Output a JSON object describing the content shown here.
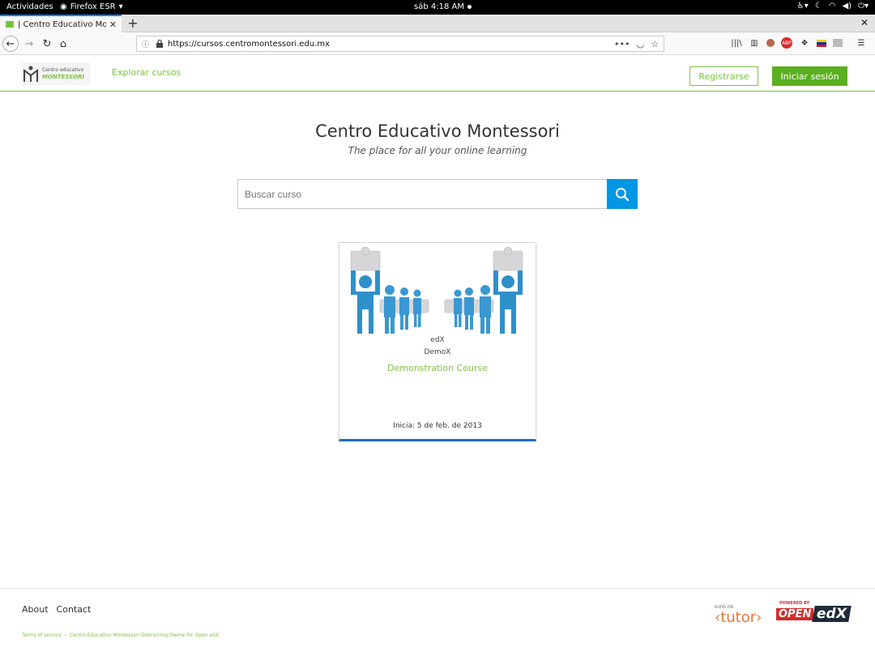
{
  "system": {
    "activities": "Actividades",
    "app_name": "Firefox ESR",
    "clock": "sáb 4:18 AM"
  },
  "browser": {
    "tab_title": "| Centro Educativo Monte",
    "url": "https://cursos.centromontessori.edu.mx"
  },
  "header": {
    "logo_line1": "Centro educativo",
    "logo_line2": "MONTESSORI",
    "explore_label": "Explorar cursos",
    "register_label": "Registrarse",
    "signin_label": "Iniciar sesión"
  },
  "hero": {
    "title": "Centro Educativo Montessori",
    "subtitle": "The place for all your online learning"
  },
  "search": {
    "placeholder": "Buscar curso"
  },
  "course": {
    "org": "edX",
    "number": "DemoX",
    "name": "Demonstration Course",
    "start": "Inicia: 5 de feb. de 2013"
  },
  "footer": {
    "about": "About",
    "contact": "Contact",
    "terms": "Terms of service",
    "theme_credit": "Centro Educativo Montessori Debraining theme for Open edX",
    "runs_on": "RUNS ON",
    "tutor": "‹tutor›",
    "powered_by": "POWERED BY",
    "open": "OPEN",
    "edx": "edX"
  },
  "colors": {
    "brand_green": "#7cc242",
    "signin_green": "#5ab01e",
    "search_blue": "#0096e6",
    "card_border_blue": "#1f6fb2"
  }
}
